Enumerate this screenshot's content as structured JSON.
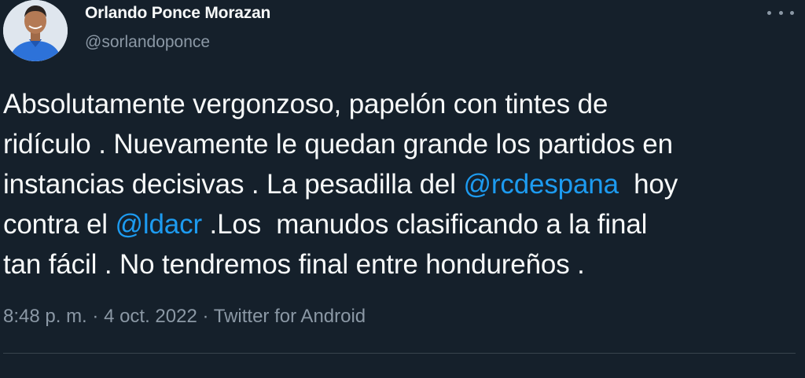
{
  "author": {
    "display_name": "Orlando Ponce Morazan",
    "handle": "@sorlandoponce",
    "avatar_icon": "user-avatar-photo"
  },
  "more_icon": "more-options-icon",
  "tweet": {
    "lines": [
      [
        "Absolutamente vergonzoso, papelón con tintes de"
      ],
      [
        "ridículo . Nuevamente le quedan grande los partidos en"
      ],
      [
        "instancias decisivas . La pesadilla del ",
        "@rcdespana",
        "  hoy"
      ],
      [
        "contra el ",
        "@ldacr",
        " .Los  manudos clasificando a la final"
      ],
      [
        "tan fácil . No tendremos final entre hondureños ."
      ]
    ]
  },
  "meta": {
    "time": "8:48 p. m.",
    "separator": " · ",
    "date": "4 oct. 2022",
    "source": "Twitter for Android"
  },
  "colors": {
    "background": "#15202b",
    "text": "#f7f9f9",
    "secondary": "#8b98a5",
    "link": "#1d9bf0",
    "divider": "#38444d"
  }
}
